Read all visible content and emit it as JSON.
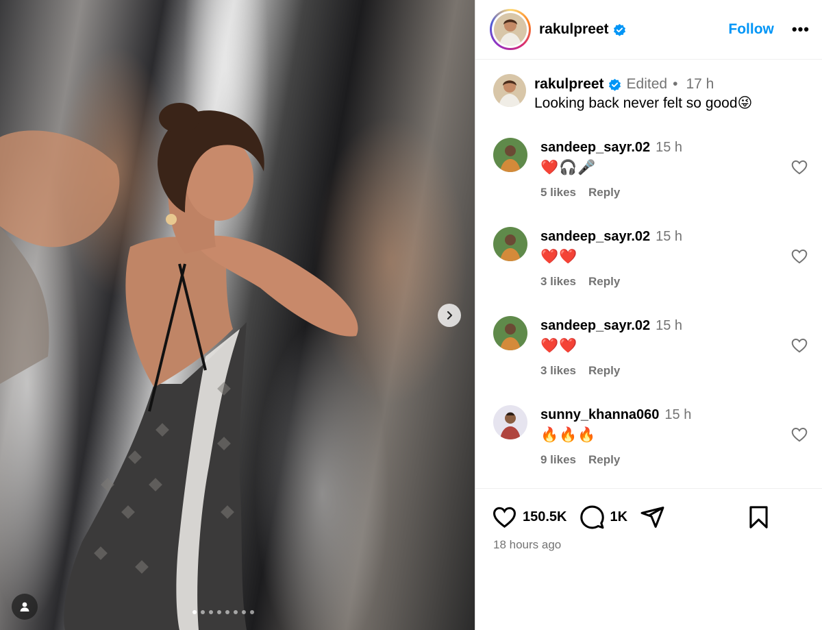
{
  "post": {
    "author": "rakulpreet",
    "follow_label": "Follow",
    "more_label": "•••",
    "caption": {
      "username": "rakulpreet",
      "edited_label": "Edited",
      "separator": "•",
      "time": "17 h",
      "text": "Looking back never felt so good😜"
    },
    "media": {
      "next_icon": "chevron-right-icon",
      "tag_icon": "user-tag-icon",
      "slide_count": 8,
      "active_slide": 1
    }
  },
  "comments": [
    {
      "username": "sandeep_sayr.02",
      "time": "15 h",
      "text": "❤️🎧🎤",
      "likes": "5 likes",
      "reply": "Reply"
    },
    {
      "username": "sandeep_sayr.02",
      "time": "15 h",
      "text": "❤️❤️",
      "likes": "3 likes",
      "reply": "Reply"
    },
    {
      "username": "sandeep_sayr.02",
      "time": "15 h",
      "text": "❤️❤️",
      "likes": "3 likes",
      "reply": "Reply"
    },
    {
      "username": "sunny_khanna060",
      "time": "15 h",
      "text": "🔥🔥🔥",
      "likes": "9 likes",
      "reply": "Reply"
    }
  ],
  "actions": {
    "likes": "150.5K",
    "comments": "1K",
    "timestamp": "18 hours ago"
  },
  "colors": {
    "accent": "#0095f6",
    "muted": "#737373",
    "verified": "#0095f6"
  }
}
